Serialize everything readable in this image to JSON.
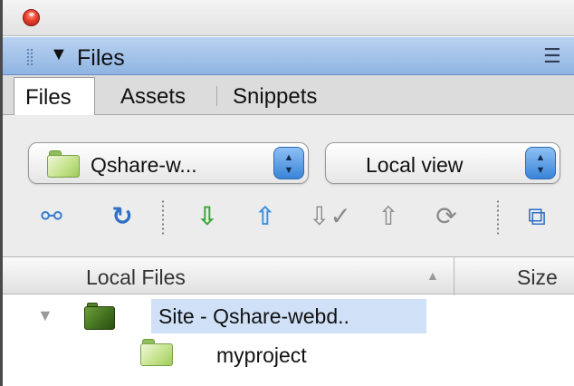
{
  "panel": {
    "title": "Files",
    "collapse_icon": "disclosure-triangle-down-icon",
    "options_icon": "panel-options-menu-icon"
  },
  "tabs": [
    {
      "label": "Files",
      "active": true
    },
    {
      "label": "Assets",
      "active": false
    },
    {
      "label": "Snippets",
      "active": false
    }
  ],
  "site_select": {
    "value": "Qshare-w...",
    "icon": "folder-icon"
  },
  "view_select": {
    "value": "Local view"
  },
  "toolbar": [
    {
      "name": "connect-icon"
    },
    {
      "name": "refresh-icon"
    },
    {
      "name": "get-files-icon"
    },
    {
      "name": "put-files-icon"
    },
    {
      "name": "check-out-icon"
    },
    {
      "name": "check-in-icon"
    },
    {
      "name": "synchronize-icon"
    },
    {
      "name": "expand-icon"
    }
  ],
  "columns": {
    "local_files": "Local Files",
    "size": "Size"
  },
  "tree": [
    {
      "label": "Site - Qshare-webd..",
      "selected": true,
      "expanded": true
    },
    {
      "label": "myproject",
      "selected": false
    }
  ],
  "colors": {
    "header_blue": "#9bbde6",
    "selected_row": "#cfe0f7",
    "stepper_blue": "#3a84d8",
    "folder_green": "#9fca5c"
  }
}
